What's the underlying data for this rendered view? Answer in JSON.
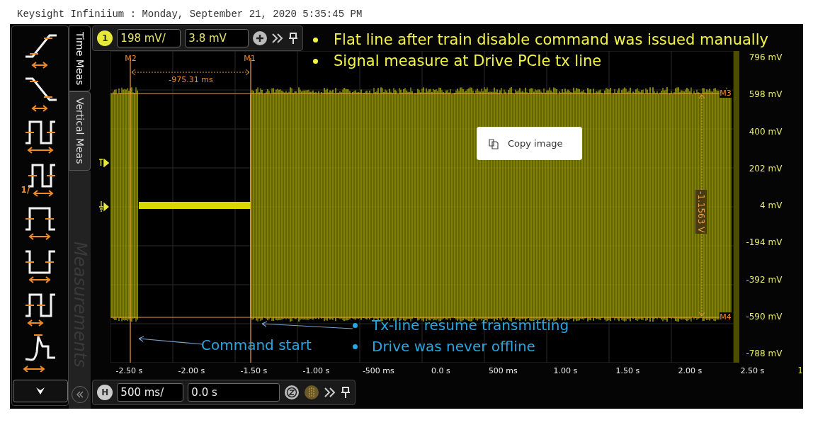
{
  "title": "Keysight Infiniium : Monday, September 21, 2020 5:35:45 PM",
  "meas_icons": [
    {
      "kind": "rise"
    },
    {
      "kind": "fall"
    },
    {
      "kind": "period"
    },
    {
      "kind": "frequency",
      "label": "1/"
    },
    {
      "kind": "pwidth"
    },
    {
      "kind": "nwidth"
    },
    {
      "kind": "duty"
    },
    {
      "kind": "overshoot"
    }
  ],
  "side_tabs": [
    {
      "label": "Time Meas",
      "selected": true
    },
    {
      "label": "Vertical Meas",
      "selected": false
    }
  ],
  "side_panel_label": "Measurements",
  "channel_bar": {
    "channel": "1",
    "scale": "198 mV/",
    "offset": "3.8 mV"
  },
  "markers": {
    "m2": "M2",
    "m1": "M1",
    "m3": "M3",
    "m4": "M4",
    "delta_x": "-975.31 ms",
    "delta_y": "-1.1563 V"
  },
  "y_ticks": [
    "796 mV",
    "598 mV",
    "400 mV",
    "202 mV",
    "4 mV",
    "-194 mV",
    "-392 mV",
    "-590 mV",
    "-788 mV"
  ],
  "x_ticks": [
    "-2.50 s",
    "-2.00 s",
    "-1.50 s",
    "-1.00 s",
    "-500 ms",
    "0.0 s",
    "500 ms",
    "1.00 s",
    "1.50 s",
    "2.00 s",
    "2.50 s"
  ],
  "corner_label": "1",
  "horizontal_bar": {
    "badge": "H",
    "scale": "500 ms/",
    "position": "0.0 s"
  },
  "notes_top": [
    "Flat line after train disable command was issued manually",
    "Signal measure at Drive PCIe tx line"
  ],
  "notes_bottom": [
    "Tx-line resume transmitting",
    "Drive was never offline"
  ],
  "callout": "Command start",
  "context_menu": {
    "items": [
      {
        "label": "Copy image"
      }
    ]
  }
}
